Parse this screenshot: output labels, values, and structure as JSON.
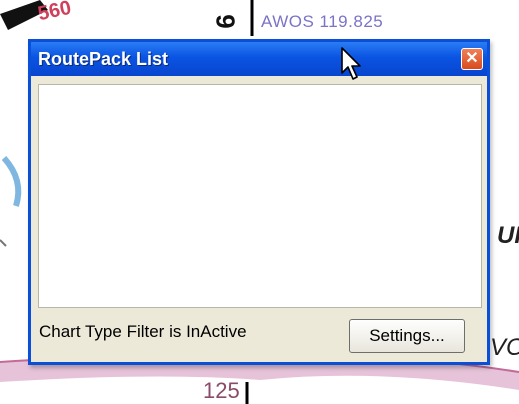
{
  "background": {
    "awos_label": "AWOS 119.825",
    "awos_digit": "9",
    "altitude_top": "560",
    "altitude_bottom": "125",
    "right_text_upper": "UI",
    "right_text_lower": "VO"
  },
  "window": {
    "title": "RoutePack List",
    "close_glyph": "✕",
    "status_text": "Chart Type Filter is InActive",
    "settings_label": "Settings...",
    "list_items": []
  },
  "colors": {
    "title_bar": "#0a54e2",
    "window_border": "#0a4fd8",
    "window_face": "#ece9d8",
    "close_button": "#d84a1c"
  },
  "icons": {
    "close": "close-icon",
    "cursor": "mouse-pointer-icon"
  }
}
